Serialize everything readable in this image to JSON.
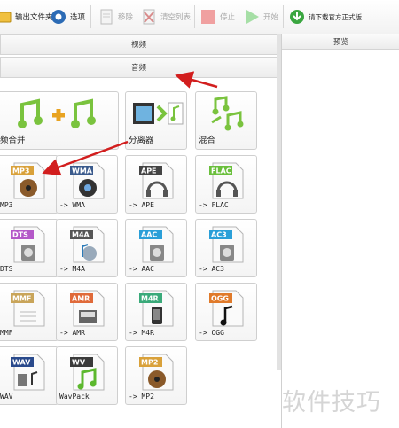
{
  "toolbar": {
    "output_folder": "输出文件夹",
    "options": "选项",
    "remove": "移除",
    "clear_list": "清空列表",
    "stop": "停止",
    "start": "开始",
    "download": "请下载官方正式版"
  },
  "tabs": {
    "video": "视频",
    "audio": "音频"
  },
  "preview": {
    "title": "预览"
  },
  "tools": [
    {
      "label": "频合并",
      "icon": "audio-merge-icon"
    },
    {
      "label": "分离器",
      "icon": "audio-splitter-icon"
    },
    {
      "label": "混合",
      "icon": "audio-mix-icon"
    }
  ],
  "formats": [
    {
      "tag": "MP3",
      "label": "MP3",
      "color": "#d9a13a",
      "glyph": "speaker-disc"
    },
    {
      "tag": "WMA",
      "label": "-> WMA",
      "color": "#3a5a8c",
      "glyph": "media-disc"
    },
    {
      "tag": "APE",
      "label": "-> APE",
      "color": "#444444",
      "glyph": "headphones"
    },
    {
      "tag": "FLAC",
      "label": "-> FLAC",
      "color": "#6abf3c",
      "glyph": "headphones"
    },
    {
      "tag": "DTS",
      "label": "DTS",
      "color": "#b458c8",
      "glyph": "speaker"
    },
    {
      "tag": "M4A",
      "label": "-> M4A",
      "color": "#555555",
      "glyph": "note-disc"
    },
    {
      "tag": "AAC",
      "label": "-> AAC",
      "color": "#2a9fd8",
      "glyph": "speaker"
    },
    {
      "tag": "AC3",
      "label": "-> AC3",
      "color": "#2a9fd8",
      "glyph": "speaker"
    },
    {
      "tag": "MMF",
      "label": "MMF",
      "color": "#c9a55a",
      "glyph": "lines"
    },
    {
      "tag": "AMR",
      "label": "-> AMR",
      "color": "#e06a3a",
      "glyph": "keyboard"
    },
    {
      "tag": "M4R",
      "label": "-> M4R",
      "color": "#3aaa7a",
      "glyph": "phone"
    },
    {
      "tag": "OGG",
      "label": "-> OGG",
      "color": "#e07a2a",
      "glyph": "note"
    },
    {
      "tag": "WAV",
      "label": "WAV",
      "color": "#2a4a8c",
      "glyph": "speaker-note"
    },
    {
      "tag": "WV",
      "label": "WavPack",
      "color": "#3a3a3a",
      "glyph": "note-green"
    },
    {
      "tag": "MP2",
      "label": "-> MP2",
      "color": "#d9a13a",
      "glyph": "speaker-disc"
    }
  ],
  "watermark": "软件技巧",
  "colors": {
    "arrow": "#d21e1e"
  }
}
